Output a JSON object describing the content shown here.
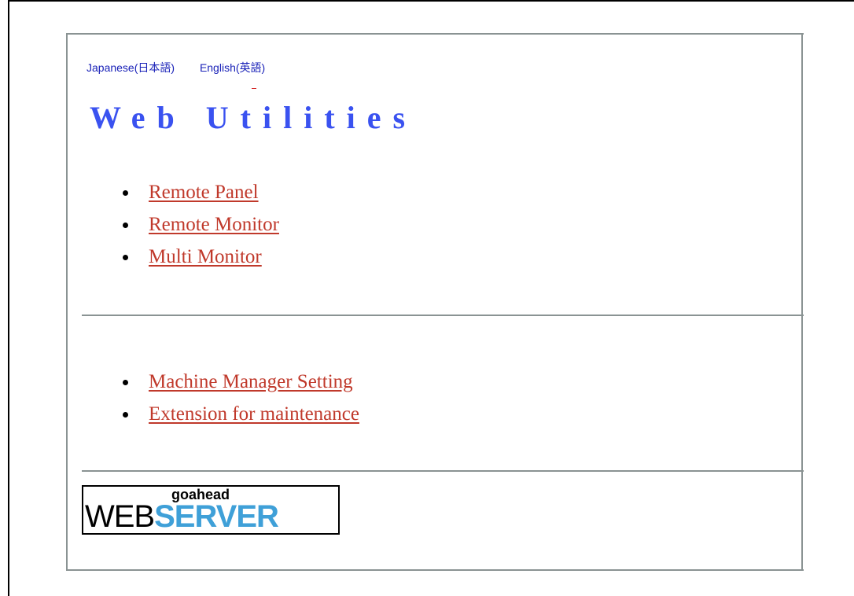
{
  "header": {
    "lang_japanese": "Japanese(日本語)",
    "lang_english": "English(英語)",
    "title": "Web Utilities"
  },
  "menu_primary": {
    "items": [
      {
        "label": "Remote Panel"
      },
      {
        "label": "Remote Monitor"
      },
      {
        "label": "Multi Monitor"
      }
    ]
  },
  "menu_secondary": {
    "items": [
      {
        "label": "Machine Manager Setting"
      },
      {
        "label": "Extension for maintenance"
      }
    ]
  },
  "footer_logo": {
    "top_text": "goahead",
    "web_text": "WEB",
    "server_text": "SERVER"
  },
  "colors": {
    "link": "#c0392b",
    "lang_link": "#1a22b8",
    "title": "#3a52f0",
    "logo_server": "#3fa0d8",
    "divider": "#8a9393"
  }
}
